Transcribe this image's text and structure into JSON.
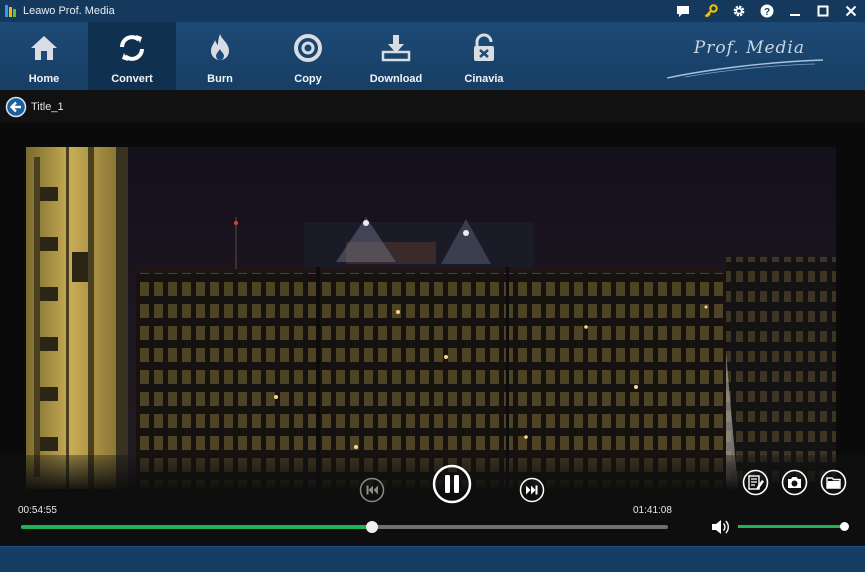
{
  "window": {
    "title": "Leawo Prof. Media"
  },
  "titlebar_icons": [
    "chat-icon",
    "key-icon",
    "gear-icon",
    "help-icon",
    "minimize-icon",
    "maximize-icon",
    "close-icon"
  ],
  "nav": [
    {
      "label": "Home",
      "icon": "home-icon",
      "active": false
    },
    {
      "label": "Convert",
      "icon": "convert-icon",
      "active": true
    },
    {
      "label": "Burn",
      "icon": "burn-icon",
      "active": false
    },
    {
      "label": "Copy",
      "icon": "copy-icon",
      "active": false
    },
    {
      "label": "Download",
      "icon": "download-icon",
      "active": false
    },
    {
      "label": "Cinavia",
      "icon": "cinavia-icon",
      "active": false
    }
  ],
  "brand": {
    "text": "Prof. Media"
  },
  "breadcrumb": {
    "title": "Title_1"
  },
  "player": {
    "current_time": "00:54:55",
    "total_time": "01:41:08",
    "progress": 0.543,
    "volume": 1.0,
    "state": "playing"
  },
  "colors": {
    "accent": "#1fb25a",
    "toolbar": "#1d4a76",
    "titlebar": "#14395d"
  }
}
